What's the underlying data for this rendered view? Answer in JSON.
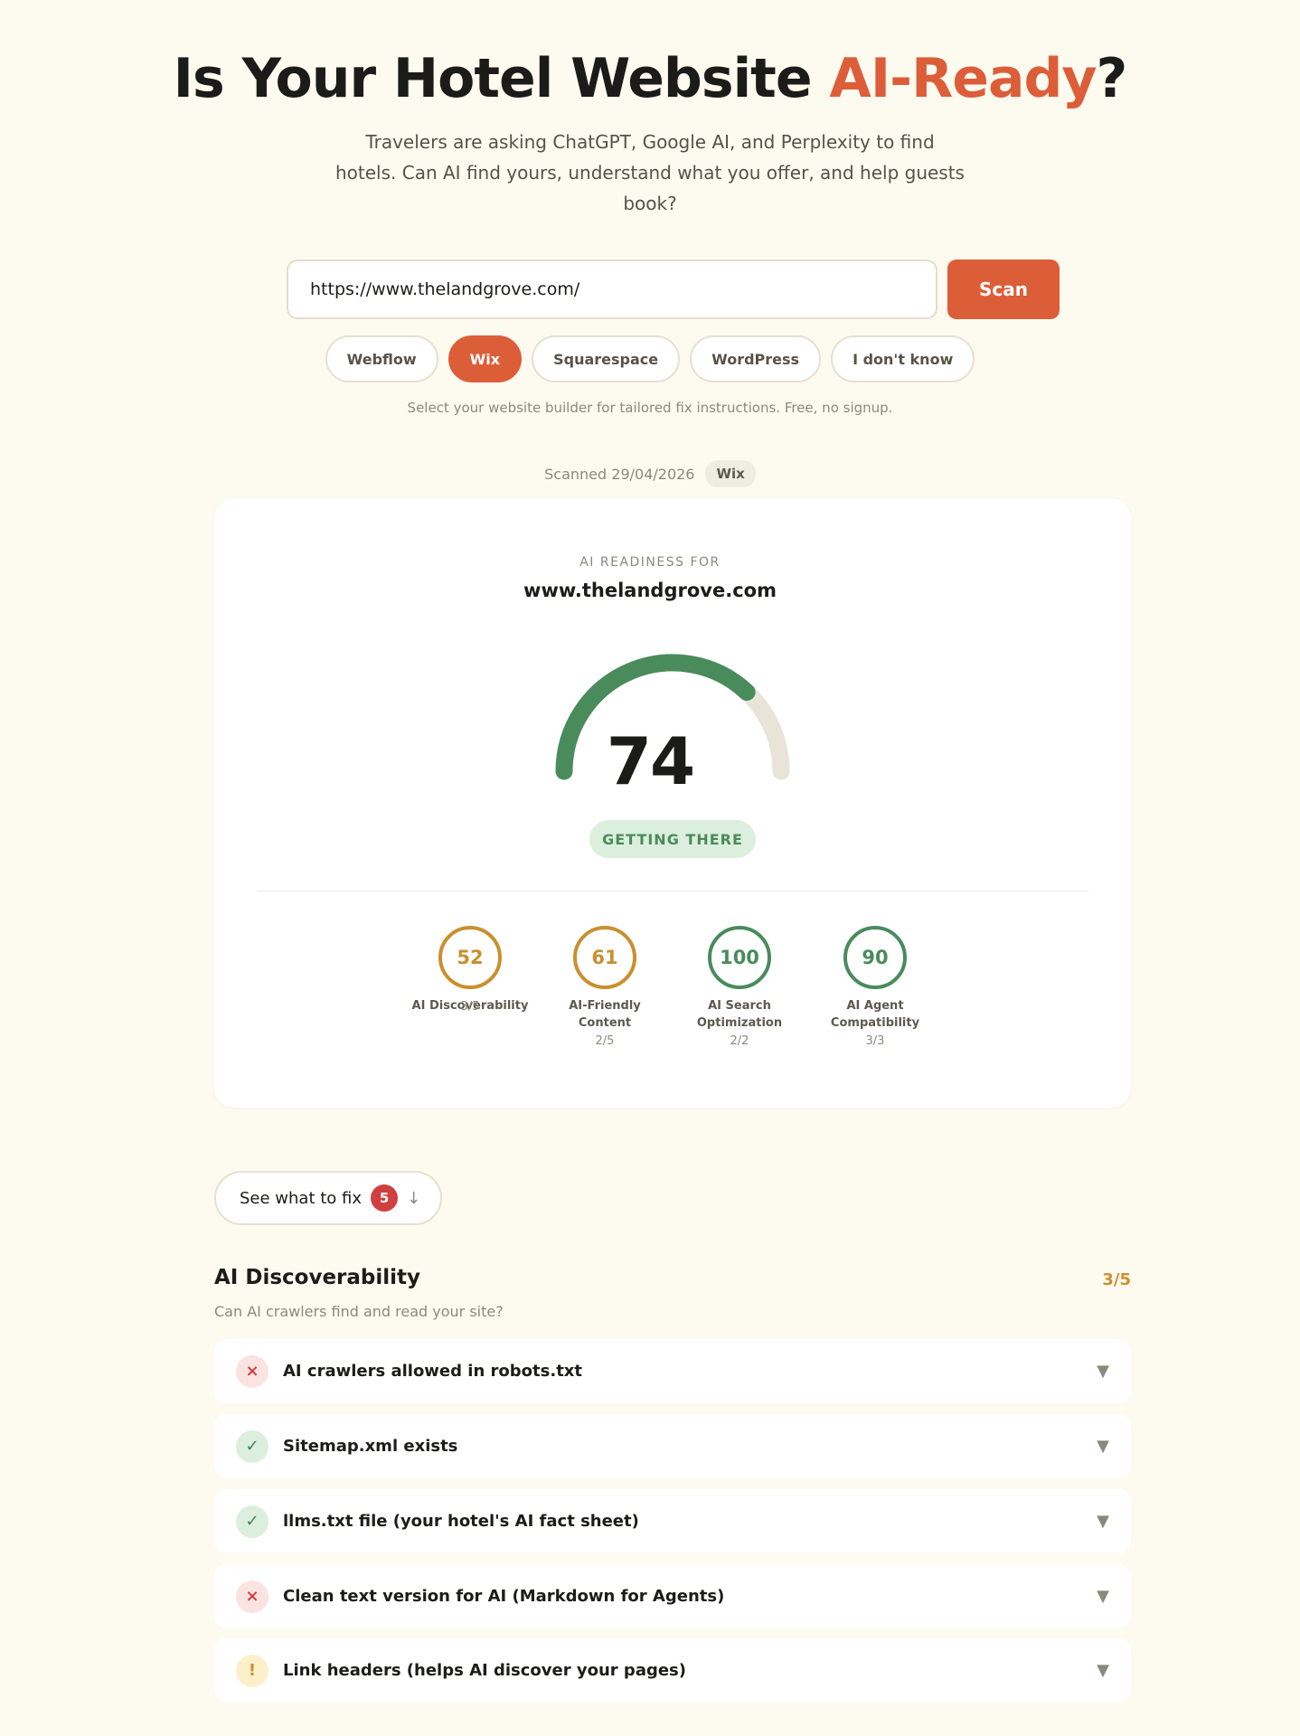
{
  "hero": {
    "title_pre": "Is Your Hotel Website ",
    "title_accent": "AI-Ready",
    "title_post": "?",
    "subtitle": "Travelers are asking ChatGPT, Google AI, and Perplexity to find hotels. Can AI find yours, understand what you offer, and help guests book?"
  },
  "scan": {
    "url_value": "https://www.thelandgrove.com/",
    "button_label": "Scan"
  },
  "builders": {
    "options": [
      "Webflow",
      "Wix",
      "Squarespace",
      "WordPress",
      "I don't know"
    ],
    "selected": "Wix",
    "helper": "Select your website builder for tailored fix instructions. Free, no signup."
  },
  "scan_meta": {
    "scanned_label": "Scanned 29/04/2026",
    "builder_badge": "Wix"
  },
  "report": {
    "ready_for_label": "AI READINESS FOR",
    "domain": "www.thelandgrove.com",
    "score": "74",
    "score_fraction": 0.74,
    "status": "GETTING THERE",
    "categories": [
      {
        "score": "52",
        "name_line1": "AI Discoverability",
        "name_line2": "",
        "fraction": "3/5",
        "color": "#c9902f"
      },
      {
        "score": "61",
        "name_line1": "AI-Friendly",
        "name_line2": "Content",
        "fraction": "2/5",
        "color": "#c9902f"
      },
      {
        "score": "100",
        "name_line1": "AI Search",
        "name_line2": "Optimization",
        "fraction": "2/2",
        "color": "#4a8b5c"
      },
      {
        "score": "90",
        "name_line1": "AI Agent",
        "name_line2": "Compatibility",
        "fraction": "3/3",
        "color": "#4a8b5c"
      }
    ]
  },
  "fix": {
    "label": "See what to fix",
    "count": "5",
    "arrow": "↓"
  },
  "section": {
    "title": "AI Discoverability",
    "score": "3/5",
    "subtitle": "Can AI crawlers find and read your site?",
    "checks": [
      {
        "label": "AI crawlers allowed in robots.txt",
        "status": "fail",
        "icon": "×"
      },
      {
        "label": "Sitemap.xml exists",
        "status": "pass",
        "icon": "✓"
      },
      {
        "label": "llms.txt file (your hotel's AI fact sheet)",
        "status": "pass",
        "icon": "✓"
      },
      {
        "label": "Clean text version for AI (Markdown for Agents)",
        "status": "fail",
        "icon": "×"
      },
      {
        "label": "Link headers (helps AI discover your pages)",
        "status": "warn",
        "icon": "!"
      }
    ],
    "chevron": "▼"
  },
  "colors": {
    "accent": "#dc5e39",
    "gauge_fill": "#4a8b5c",
    "gauge_track": "#e8e4d8",
    "warn": "#c9902f",
    "pass": "#4a8b5c",
    "fail": "#cf3f3f"
  }
}
